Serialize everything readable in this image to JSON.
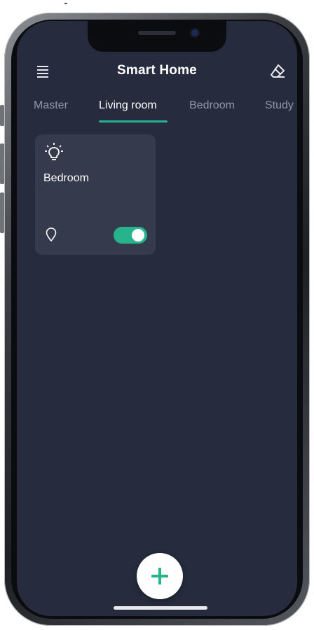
{
  "app": {
    "title": "Smart Home"
  },
  "tabs": [
    {
      "label": "Master",
      "active": false
    },
    {
      "label": "Living room",
      "active": true
    },
    {
      "label": "Bedroom",
      "active": false
    },
    {
      "label": "Study",
      "active": false
    }
  ],
  "devices": [
    {
      "name": "Bedroom",
      "icon": "lightbulb-icon",
      "status_icon": "location-pin-icon",
      "on": true
    }
  ],
  "icons": {
    "menu": "menu-icon",
    "edit": "eraser-icon",
    "add": "plus-icon"
  },
  "colors": {
    "background": "#262c3d",
    "card": "#353b4c",
    "accent": "#27b38c",
    "text_primary": "#ffffff",
    "text_inactive": "#8f96a8"
  }
}
